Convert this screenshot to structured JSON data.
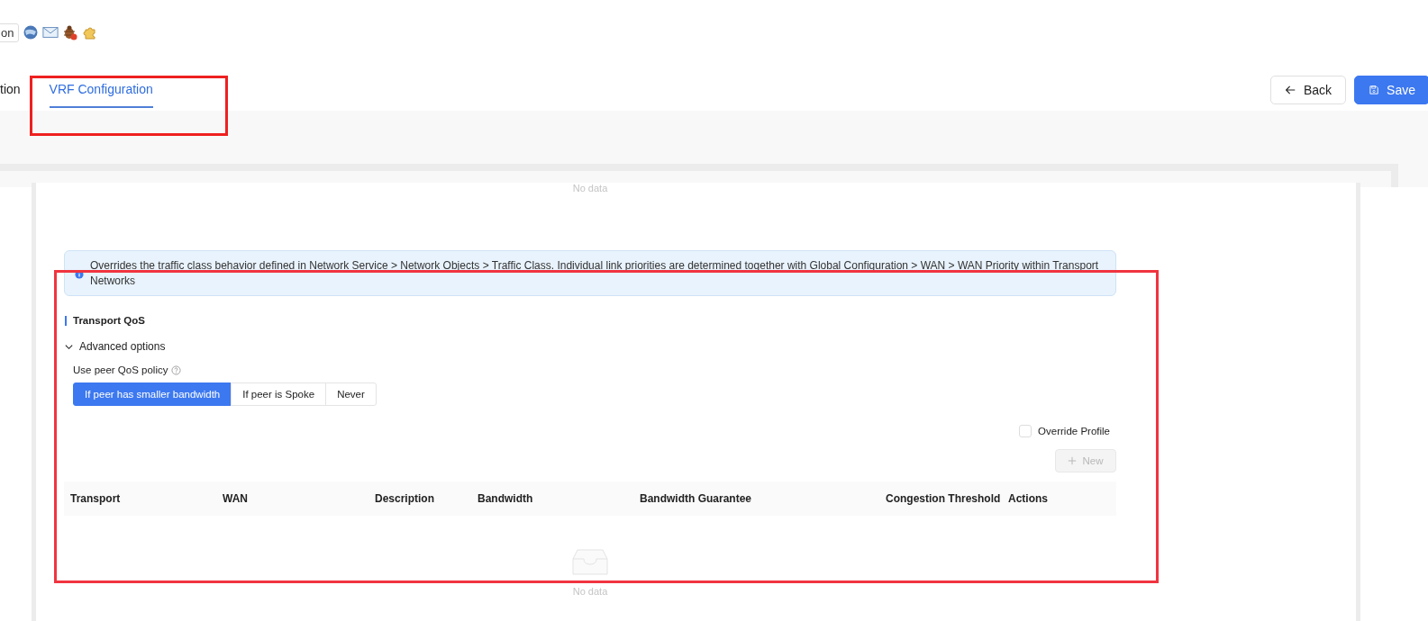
{
  "toolbar": {
    "button_fragment": "on"
  },
  "tabs": [
    {
      "label": "tion",
      "selected": false
    },
    {
      "label": "VRF Configuration",
      "selected": true
    }
  ],
  "actions": [
    {
      "kind": "back",
      "label": "Back"
    },
    {
      "kind": "save",
      "label": "Save"
    }
  ],
  "top_empty": {
    "text": "No data"
  },
  "alert": {
    "text": "Overrides the traffic class behavior defined in Network Service > Network Objects > Traffic Class. Individual link priorities are determined together with Global Configuration > WAN > WAN Priority within Transport Networks"
  },
  "section_title": "Transport QoS",
  "advanced": {
    "label": "Advanced options",
    "expanded": true
  },
  "policy": {
    "label": "Use peer QoS policy",
    "options": [
      {
        "label": "If peer has smaller bandwidth",
        "selected": true
      },
      {
        "label": "If peer is Spoke",
        "selected": false
      },
      {
        "label": "Never",
        "selected": false
      }
    ]
  },
  "override": {
    "label": "Override Profile",
    "checked": false
  },
  "new_button": {
    "label": "New",
    "disabled": true
  },
  "table": {
    "columns": [
      "Transport",
      "WAN",
      "Description",
      "Bandwidth",
      "Bandwidth Guarantee",
      "Congestion Threshold",
      "Actions"
    ],
    "empty": "No data"
  }
}
